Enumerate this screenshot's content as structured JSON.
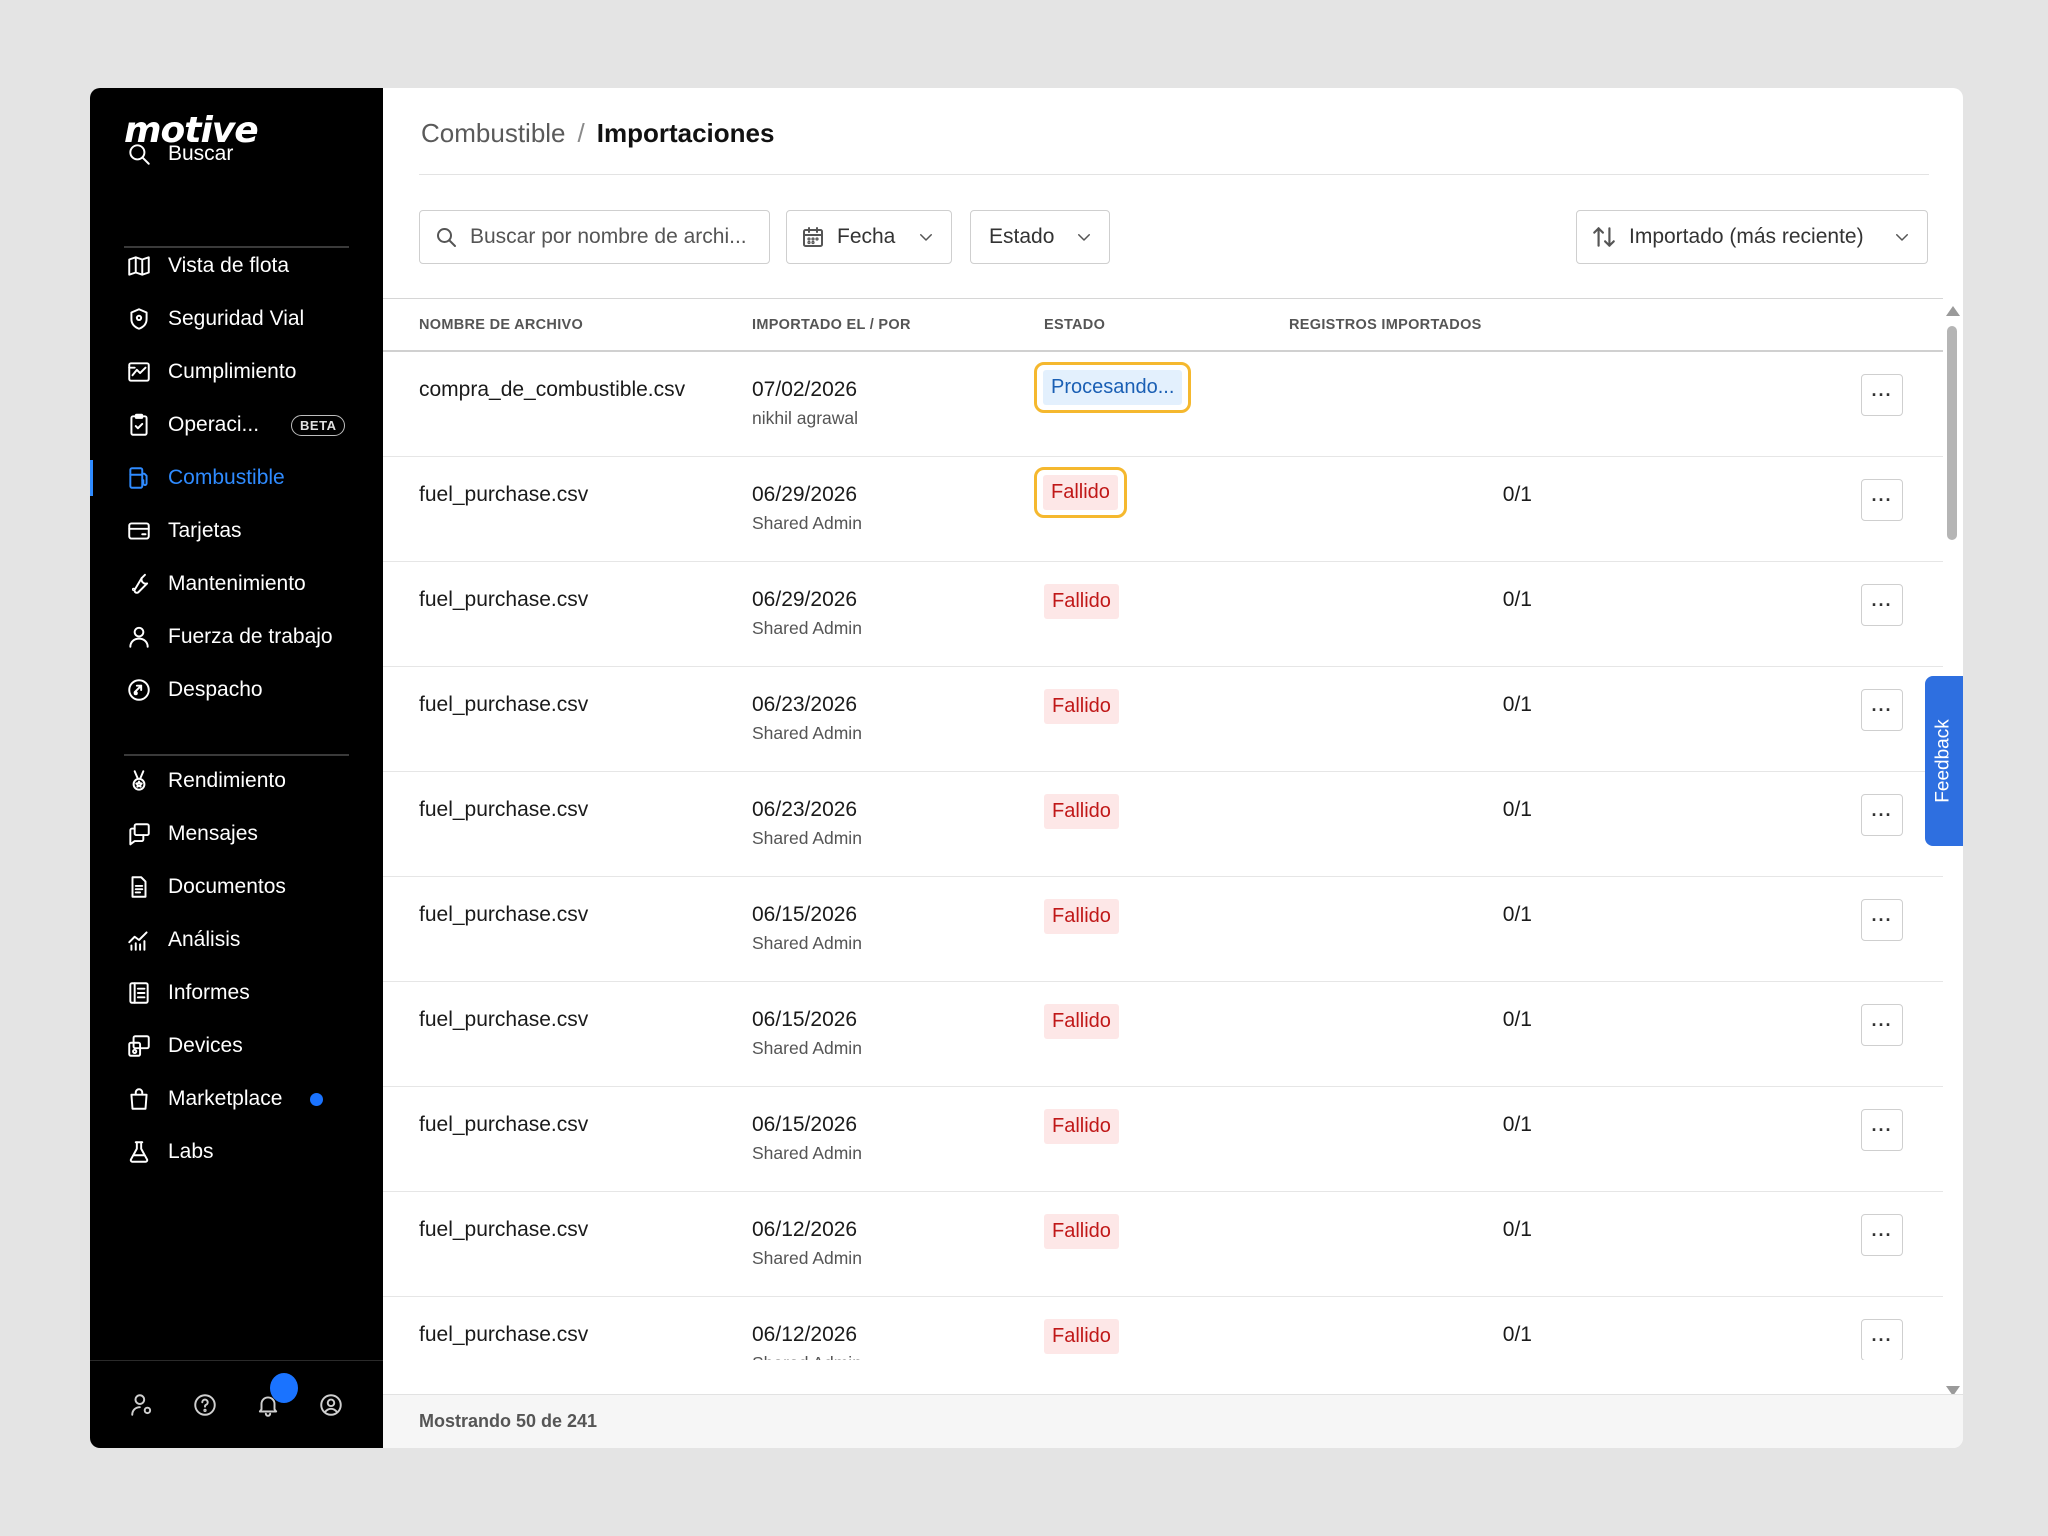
{
  "brand": {
    "logo": "motive"
  },
  "sidebar": {
    "search_label": "Buscar",
    "items": [
      {
        "label": "Vista de flota",
        "icon": "map-icon"
      },
      {
        "label": "Seguridad Vial",
        "icon": "shield-icon"
      },
      {
        "label": "Cumplimiento",
        "icon": "compliance-chart-icon"
      },
      {
        "label": "Operaci...",
        "icon": "clipboard-icon",
        "badge": "BETA"
      },
      {
        "label": "Combustible",
        "icon": "fuel-pump-icon",
        "active": true
      },
      {
        "label": "Tarjetas",
        "icon": "card-icon"
      },
      {
        "label": "Mantenimiento",
        "icon": "wrench-icon"
      },
      {
        "label": "Fuerza de trabajo",
        "icon": "person-icon"
      },
      {
        "label": "Despacho",
        "icon": "dispatch-tag-icon"
      },
      {
        "label": "Rendimiento",
        "icon": "medal-icon"
      },
      {
        "label": "Mensajes",
        "icon": "messages-icon"
      },
      {
        "label": "Documentos",
        "icon": "document-icon"
      },
      {
        "label": "Análisis",
        "icon": "analytics-icon"
      },
      {
        "label": "Informes",
        "icon": "reports-icon"
      },
      {
        "label": "Devices",
        "icon": "devices-icon"
      },
      {
        "label": "Marketplace",
        "icon": "bag-icon",
        "has_dot": true
      },
      {
        "label": "Labs",
        "icon": "flask-icon"
      }
    ],
    "footer_icons": [
      "user-settings-icon",
      "help-icon",
      "bell-icon",
      "account-icon"
    ]
  },
  "breadcrumb": {
    "parent": "Combustible",
    "separator": "/",
    "current": "Importaciones"
  },
  "toolbar": {
    "search_placeholder": "Buscar por nombre de archi...",
    "date_filter": "Fecha",
    "status_filter": "Estado",
    "sort_label": "Importado (más reciente)"
  },
  "table": {
    "headers": {
      "file": "NOMBRE DE ARCHIVO",
      "imported": "IMPORTADO EL / POR",
      "status": "ESTADO",
      "records": "REGISTROS IMPORTADOS"
    },
    "rows": [
      {
        "file": "compra_de_combustible.csv",
        "date": "07/02/2026",
        "user": "nikhil agrawal",
        "status": "Procesando...",
        "status_type": "processing",
        "records": "",
        "highlighted": true
      },
      {
        "file": "fuel_purchase.csv",
        "date": "06/29/2026",
        "user": "Shared Admin",
        "status": "Fallido",
        "status_type": "failed",
        "records": "0/1",
        "highlighted": true
      },
      {
        "file": "fuel_purchase.csv",
        "date": "06/29/2026",
        "user": "Shared Admin",
        "status": "Fallido",
        "status_type": "failed",
        "records": "0/1"
      },
      {
        "file": "fuel_purchase.csv",
        "date": "06/23/2026",
        "user": "Shared Admin",
        "status": "Fallido",
        "status_type": "failed",
        "records": "0/1"
      },
      {
        "file": "fuel_purchase.csv",
        "date": "06/23/2026",
        "user": "Shared Admin",
        "status": "Fallido",
        "status_type": "failed",
        "records": "0/1"
      },
      {
        "file": "fuel_purchase.csv",
        "date": "06/15/2026",
        "user": "Shared Admin",
        "status": "Fallido",
        "status_type": "failed",
        "records": "0/1"
      },
      {
        "file": "fuel_purchase.csv",
        "date": "06/15/2026",
        "user": "Shared Admin",
        "status": "Fallido",
        "status_type": "failed",
        "records": "0/1"
      },
      {
        "file": "fuel_purchase.csv",
        "date": "06/15/2026",
        "user": "Shared Admin",
        "status": "Fallido",
        "status_type": "failed",
        "records": "0/1"
      },
      {
        "file": "fuel_purchase.csv",
        "date": "06/12/2026",
        "user": "Shared Admin",
        "status": "Fallido",
        "status_type": "failed",
        "records": "0/1"
      },
      {
        "file": "fuel_purchase.csv",
        "date": "06/12/2026",
        "user": "Shared Admin",
        "status": "Fallido",
        "status_type": "failed",
        "records": "0/1"
      }
    ],
    "more_label": "···",
    "footer": "Mostrando 50 de 241"
  },
  "feedback_label": "Feedback",
  "colors": {
    "accent": "#2f8bff",
    "failed_text": "#c01818",
    "failed_bg": "#fde7e7",
    "processing_text": "#1a5fb4",
    "processing_bg": "#e3f0fd",
    "highlight": "#f5b82e"
  }
}
